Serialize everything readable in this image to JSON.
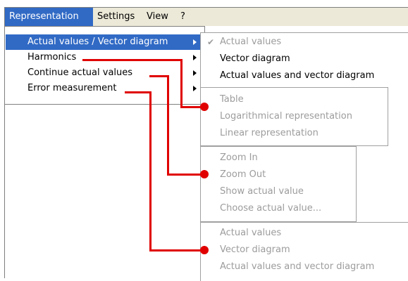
{
  "menubar": {
    "items": [
      {
        "label": "Representation"
      },
      {
        "label": "Settings"
      },
      {
        "label": "View"
      },
      {
        "label": "?"
      }
    ]
  },
  "main_menu": {
    "items": [
      {
        "label": "Actual values / Vector diagram"
      },
      {
        "label": "Harmonics"
      },
      {
        "label": "Continue actual values"
      },
      {
        "label": "Error measurement"
      }
    ]
  },
  "submenu_actual": {
    "items": [
      {
        "label": "Actual values",
        "checked": true,
        "disabled": true
      },
      {
        "label": "Vector diagram",
        "disabled": false
      },
      {
        "label": "Actual values and vector diagram",
        "disabled": false
      }
    ]
  },
  "submenu_harmonics": {
    "items": [
      {
        "label": "Table"
      },
      {
        "label": "Logarithmical  representation"
      },
      {
        "label": "Linear representation"
      }
    ]
  },
  "submenu_continue": {
    "items": [
      {
        "label": "Zoom In"
      },
      {
        "label": "Zoom Out"
      },
      {
        "label": "Show actual value"
      },
      {
        "label": "Choose actual value..."
      }
    ]
  },
  "submenu_error": {
    "items": [
      {
        "label": "Actual values"
      },
      {
        "label": "Vector diagram"
      },
      {
        "label": "Actual values and vector diagram"
      }
    ]
  },
  "icons": {
    "check": "check-icon",
    "submenu_arrow": "chevron-right-icon",
    "callout_marker": "callout-dot"
  },
  "colors": {
    "menubar_bg": "#ece9d8",
    "highlight": "#316ac5",
    "disabled_text": "#9c9c9c",
    "callout": "#e00000"
  }
}
